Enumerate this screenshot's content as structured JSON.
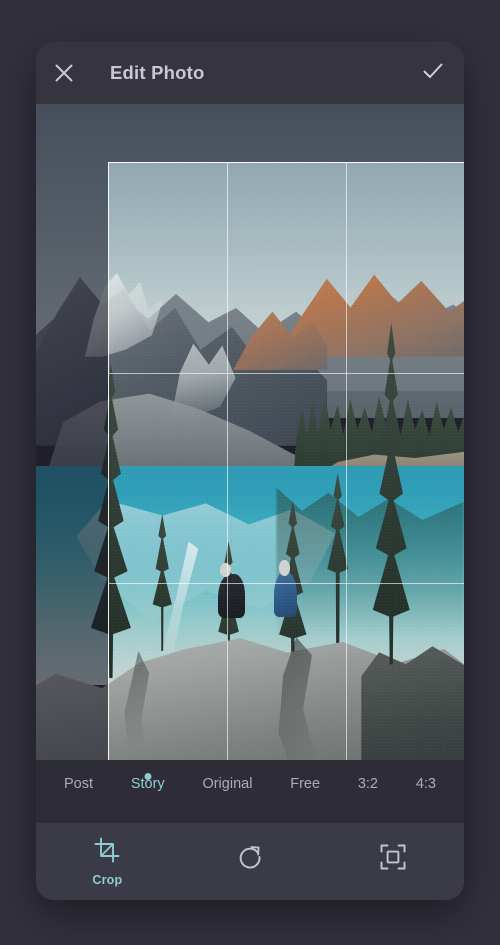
{
  "header": {
    "title": "Edit Photo",
    "close_icon": "close-icon",
    "done_icon": "check-icon"
  },
  "photo": {
    "alt": "Mountain lake with evergreen trees and two people sitting on boulders",
    "crop_grid": "rule-of-thirds"
  },
  "ratios": {
    "items": [
      {
        "label": "Post",
        "active": false
      },
      {
        "label": "Story",
        "active": true
      },
      {
        "label": "Original",
        "active": false
      },
      {
        "label": "Free",
        "active": false
      },
      {
        "label": "3:2",
        "active": false
      },
      {
        "label": "4:3",
        "active": false
      }
    ]
  },
  "toolbar": {
    "items": [
      {
        "label": "Crop",
        "icon": "crop-icon",
        "active": true
      },
      {
        "label": "",
        "icon": "rotate-icon",
        "active": false
      },
      {
        "label": "",
        "icon": "fit-frame-icon",
        "active": false
      }
    ]
  },
  "colors": {
    "accent": "#8ecdd0",
    "page_bg": "#31303c",
    "card_bg": "#35343f",
    "strip_bg": "#2d2c37",
    "toolbar_bg": "#3b3a47",
    "text": "#c7c9d4",
    "text_muted": "#a9adb9"
  }
}
